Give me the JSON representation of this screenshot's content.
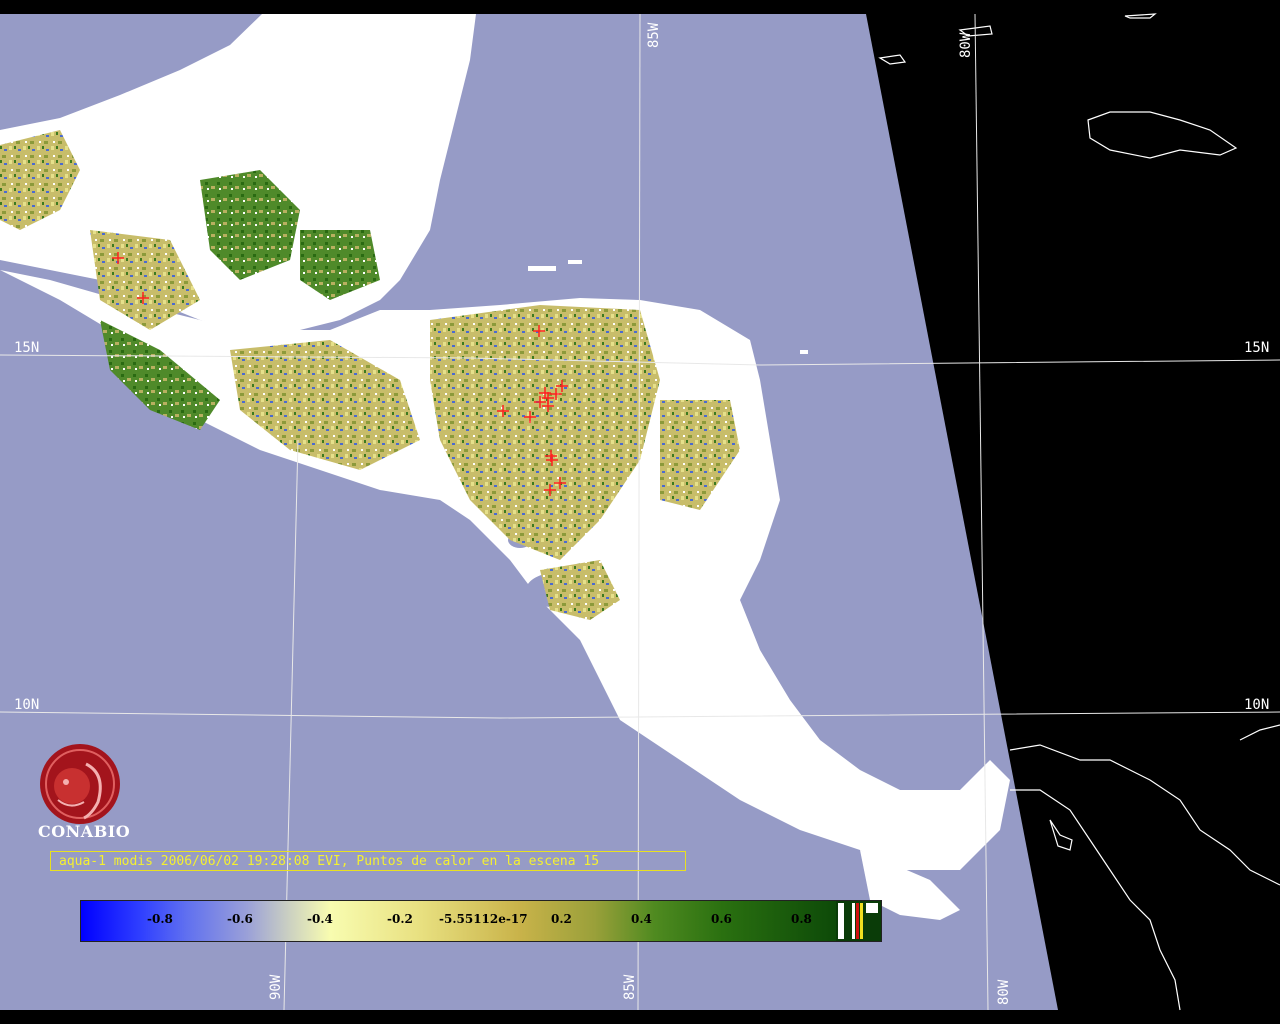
{
  "map": {
    "colors": {
      "background": "#000000",
      "water": "#969bc6",
      "cloud": "#ffffff",
      "coast": "#ffffff",
      "grid": "#e8e8e8",
      "hotspot": "#ff2020"
    },
    "grid_labels": {
      "lat_15": "15N",
      "lat_10": "10N",
      "lon_85_top": "85W",
      "lon_80_top": "80W",
      "lon_90_bottom": "90W",
      "lon_85_bottom": "85W",
      "lon_80_bottom": "80W"
    },
    "hotspot_count": 15
  },
  "logo": {
    "text": "CONABIO"
  },
  "caption": "aqua-1 modis 2006/06/02 19:28:08 EVI, Puntos de calor en la escena 15",
  "colorbar": {
    "ticks": [
      "-0.8",
      "-0.6",
      "-0.4",
      "-0.2",
      "-5.55112e-17",
      "0.2",
      "0.4",
      "0.6",
      "0.8"
    ]
  }
}
